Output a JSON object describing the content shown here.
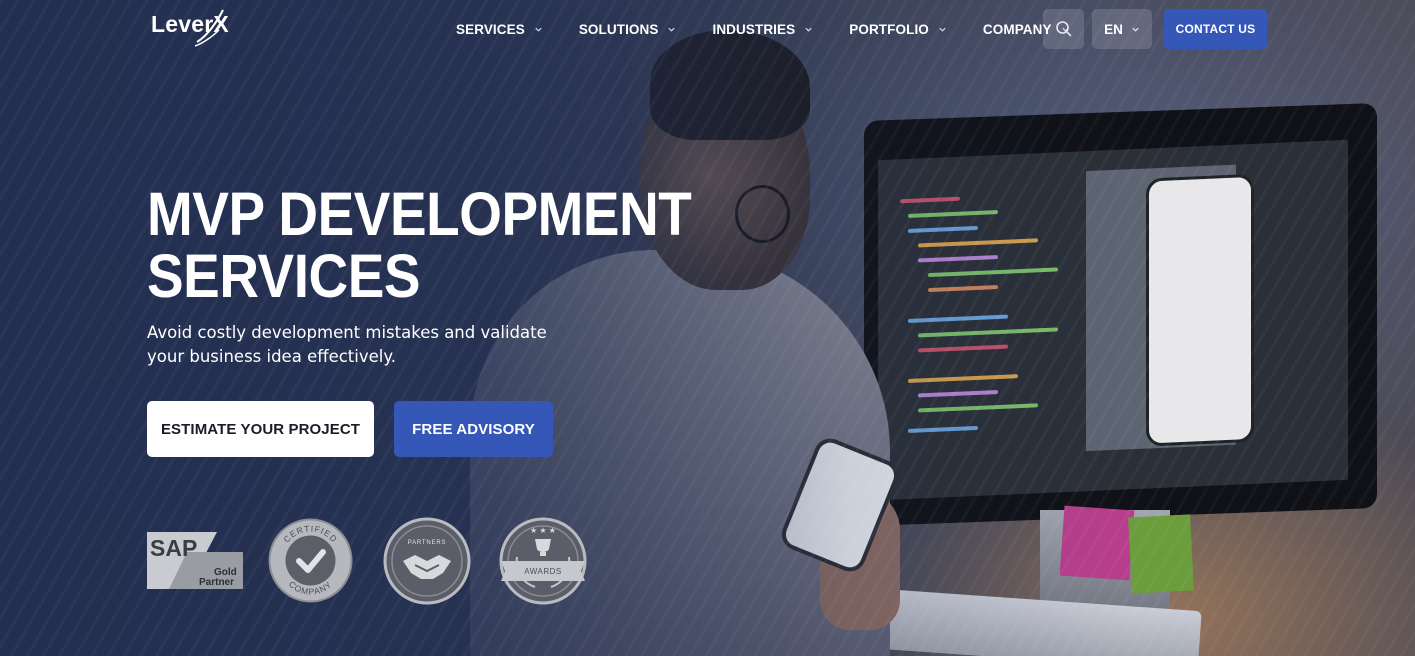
{
  "header": {
    "logo_text": "LeverX",
    "nav": [
      {
        "label": "SERVICES"
      },
      {
        "label": "SOLUTIONS"
      },
      {
        "label": "INDUSTRIES"
      },
      {
        "label": "PORTFOLIO"
      },
      {
        "label": "COMPANY"
      }
    ],
    "language": "EN",
    "contact_label": "CONTACT US"
  },
  "hero": {
    "title_line1": "MVP DEVELOPMENT",
    "title_line2": "SERVICES",
    "subtitle": "Avoid costly development mistakes and validate your business idea effectively.",
    "primary_button": "ESTIMATE YOUR PROJECT",
    "secondary_button": "FREE ADVISORY"
  },
  "badges": {
    "sap_top": "SAP",
    "sap_line1": "Gold",
    "sap_line2": "Partner",
    "certified_top": "CERTIFIED",
    "certified_bottom": "COMPANY",
    "partners_label": "PARTNERS",
    "awards_label": "AWARDS"
  },
  "colors": {
    "accent": "#3457b8",
    "text": "#ffffff"
  }
}
